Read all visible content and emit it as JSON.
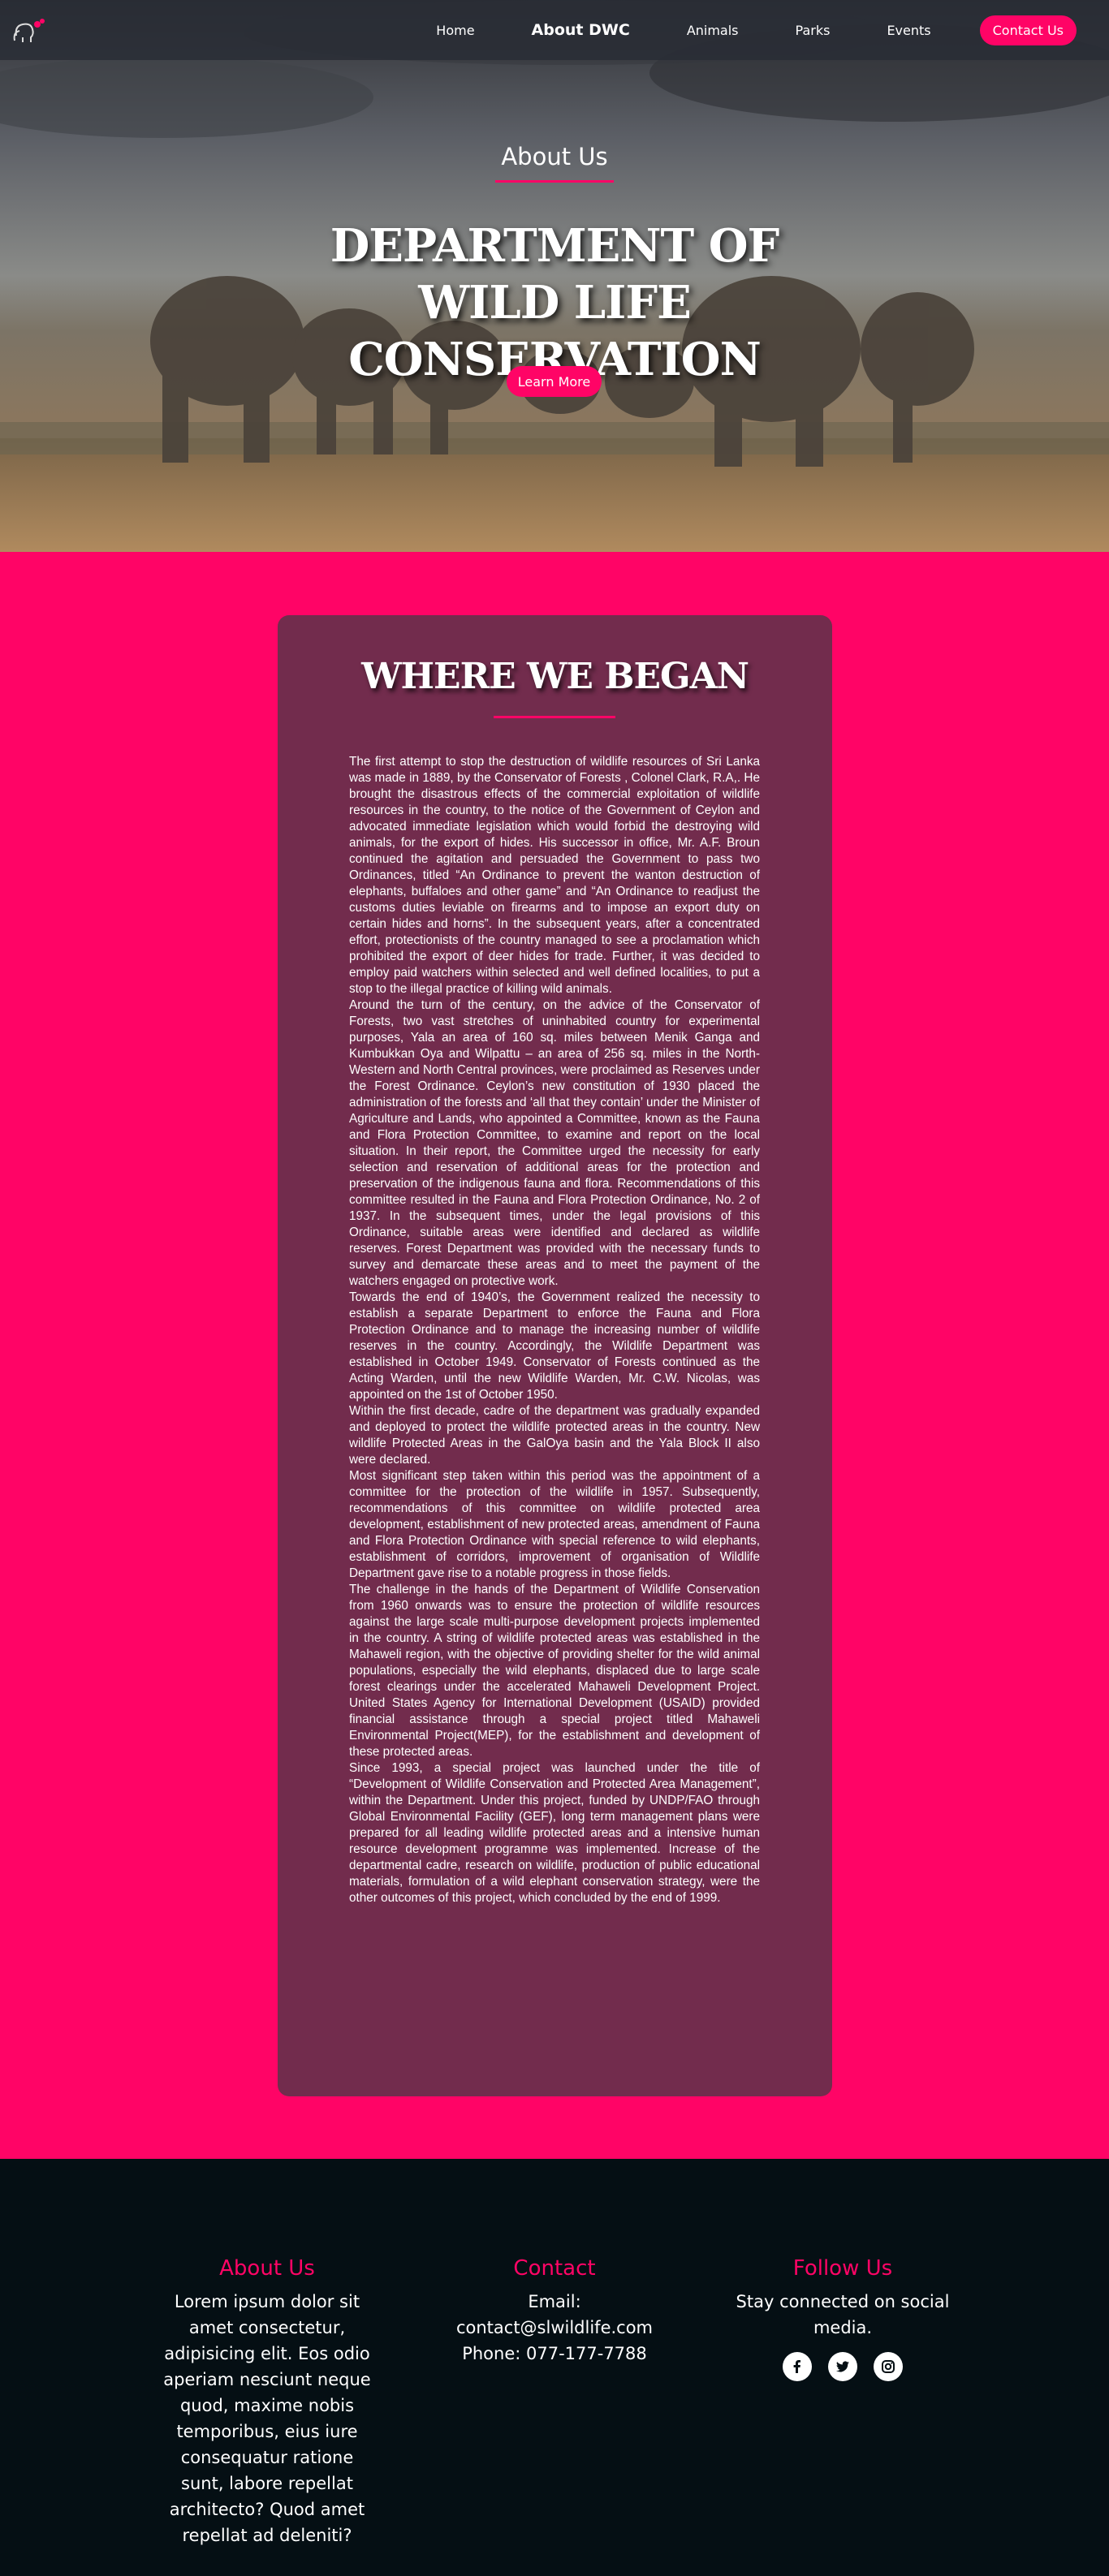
{
  "nav": {
    "logo_icon": "elephant-logo-icon",
    "links": [
      "Home",
      "About DWC",
      "Animals",
      "Parks",
      "Events"
    ],
    "cta": "Contact Us"
  },
  "hero": {
    "subtitle": "About Us",
    "title": "DEPARTMENT OF WILD LIFE CONSERVATION",
    "button": "Learn More"
  },
  "section": {
    "title": "WHERE WE BEGAN",
    "paragraphs": [
      "The first attempt to stop the destruction of wildlife resources of Sri Lanka was made in 1889, by the Conservator of Forests , Colonel Clark, R.A,. He brought the disastrous effects of the commercial exploitation of wildlife resources in the country, to the notice of the Government of Ceylon and advocated immediate legislation which would forbid the destroying wild animals, for the export of hides. His successor in office, Mr. A.F. Broun continued the agitation and persuaded the Government to pass two Ordinances, titled “An Ordinance to prevent the wanton destruction of elephants, buffaloes and other game” and “An Ordinance to readjust the customs duties leviable on firearms and to impose an export duty on certain hides and horns”. In the subsequent years, after a concentrated effort, protectionists of the country managed to see a proclamation which prohibited the export of deer hides for trade. Further, it was decided to employ paid watchers within selected and well defined localities, to put a stop to the illegal practice of killing wild animals.",
      "Around the turn of the century, on the advice of the Conservator of Forests, two vast stretches of uninhabited country for experimental purposes, Yala an area of 160 sq. miles between Menik Ganga and Kumbukkan Oya and Wilpattu – an area of 256 sq. miles in the North-Western and North Central provinces, were proclaimed as Reserves under the Forest Ordinance. Ceylon’s new constitution of 1930 placed the administration of the forests and ‘all that they contain’ under the Minister of Agriculture and Lands, who appointed a Committee, known as the Fauna and Flora Protection Committee, to examine and report on the local situation. In their report, the Committee urged the necessity for early selection and reservation of additional areas for the protection and preservation of the indigenous fauna and flora. Recommendations of this committee resulted in the Fauna and Flora Protection Ordinance, No. 2 of 1937. In the subsequent times, under the legal provisions of this Ordinance, suitable areas were identified and declared as wildlife reserves. Forest Department was provided with the necessary funds to survey and demarcate these areas and to meet the payment of the watchers engaged on protective work.",
      "Towards the end of 1940’s, the Government realized the necessity to establish a separate Department to enforce the Fauna and Flora Protection Ordinance and to manage the increasing number of wildlife reserves in the country. Accordingly, the Wildlife Department was established in October 1949. Conservator of Forests continued as the Acting Warden, until the new Wildlife Warden, Mr. C.W. Nicolas, was appointed on the 1st of October 1950.",
      "Within the first decade, cadre of the department was gradually expanded and deployed to protect the wildlife protected areas in the country. New wildlife Protected Areas in the GalOya basin and the Yala Block II also were declared.",
      "Most significant step taken within this period was the appointment of a committee for the protection of the wildlife in 1957. Subsequently, recommendations of this committee on wildlife protected area development, establishment of new protected areas, amendment of Fauna and Flora Protection Ordinance with special reference to wild elephants, establishment of corridors, improvement of organisation of Wildlife Department gave rise to a notable progress in those fields.",
      "The challenge in the hands of the Department of Wildlife Conservation from 1960 onwards was to ensure the protection of wildlife resources against the large scale multi-purpose development projects implemented in the country. A string of wildlife protected areas was established in the Mahaweli region, with the objective of providing shelter for the wild animal populations, especially the wild elephants, displaced due to large scale forest clearings under the accelerated Mahaweli Development Project. United States Agency for International Development (USAID) provided financial assistance through a special project titled Mahaweli Environmental Project(MEP), for the establishment and development of these protected areas.",
      "Since 1993, a special project was launched under the title of “Development of Wildlife Conservation and Protected Area Management”, within the Department. Under this project, funded by UNDP/FAO through Global Environmental Facility (GEF), long term management plans were prepared for all leading wildlife protected areas and a intensive human resource development programme was implemented. Increase of the departmental cadre, research on wildlife, production of public educational materials, formulation of a wild elephant conservation strategy, were the other outcomes of this project, which concluded by the end of 1999."
    ]
  },
  "footer": {
    "about": {
      "title": "About Us",
      "text": "Lorem ipsum dolor sit amet consectetur, adipisicing elit. Eos odio aperiam nesciunt neque quod, maxime nobis temporibus, eius iure consequatur ratione sunt, labore repellat architecto? Quod amet repellat ad deleniti?"
    },
    "contact": {
      "title": "Contact",
      "email_label": "Email:",
      "email": "contact@slwildlife.com",
      "phone": "Phone: 077-177-7788"
    },
    "follow": {
      "title": "Follow Us",
      "text": "Stay connected on social media.",
      "icons": [
        "facebook-icon",
        "twitter-icon",
        "instagram-icon"
      ]
    }
  },
  "colors": {
    "accent": "#ff0466",
    "card": "#722c4d",
    "footer_bg": "#050f14"
  }
}
